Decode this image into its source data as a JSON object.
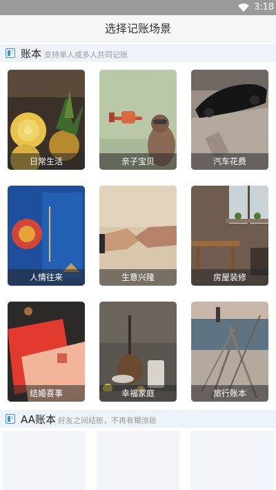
{
  "status_bar": {
    "time": "3:18",
    "wifi_icon": "wifi-icon"
  },
  "app_bar": {
    "title": "选择记账场景"
  },
  "section_ledger": {
    "title": "账本",
    "subtitle": "支持单人或多人共同记账",
    "icon": "book-icon"
  },
  "scenes": [
    {
      "label": "日常生活"
    },
    {
      "label": "亲子宝贝"
    },
    {
      "label": "汽车花费"
    },
    {
      "label": "人情往来"
    },
    {
      "label": "生意兴隆"
    },
    {
      "label": "房屋装修"
    },
    {
      "label": "结婚喜事"
    },
    {
      "label": "幸福家庭"
    },
    {
      "label": "旅行账本"
    }
  ],
  "section_aa": {
    "title": "AA账本",
    "subtitle": "好友之间结账，不再有糊涂账",
    "icon": "book-icon"
  },
  "colors": {
    "accent": "#3a8ee6",
    "header_bg": "#eef3f9",
    "status_bar": "#9a9a9a"
  }
}
